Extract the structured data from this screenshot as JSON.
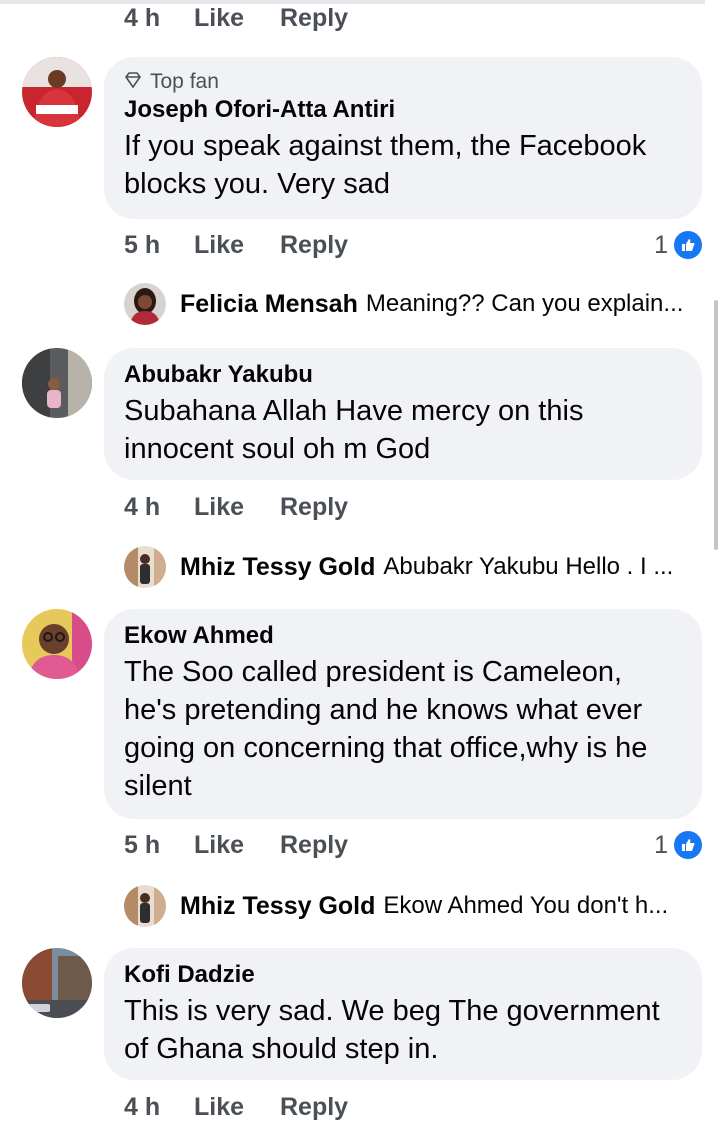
{
  "labels": {
    "like": "Like",
    "reply": "Reply"
  },
  "top_action": {
    "time": "4 h"
  },
  "comments": [
    {
      "badge": "Top fan",
      "author": "Joseph Ofori-Atta Antiri",
      "text": "If you speak against them, the Facebook blocks you. Very sad",
      "time": "5 h",
      "likes": "1",
      "reply": {
        "author": "Felicia Mensah",
        "text": "Meaning?? Can you explain..."
      }
    },
    {
      "author": "Abubakr Yakubu",
      "text": "Subahana Allah  Have mercy on this innocent soul oh m God",
      "time": "4 h",
      "reply": {
        "author": "Mhiz Tessy Gold",
        "text": "Abubakr Yakubu Hello . I ..."
      }
    },
    {
      "author": "Ekow Ahmed",
      "text": "The Soo called president is Cameleon, he's pretending and he knows what ever going on concerning that office,why is he silent",
      "time": "5 h",
      "likes": "1",
      "reply": {
        "author": "Mhiz Tessy Gold",
        "text": "Ekow Ahmed You don't h..."
      }
    },
    {
      "author": "Kofi Dadzie",
      "text": "This is very sad. We beg The government of Ghana should step in.",
      "time": "4 h"
    }
  ],
  "colors": {
    "bubble": "#f0f2f5",
    "like_blue": "#1877f2",
    "meta": "#4b4f56"
  }
}
